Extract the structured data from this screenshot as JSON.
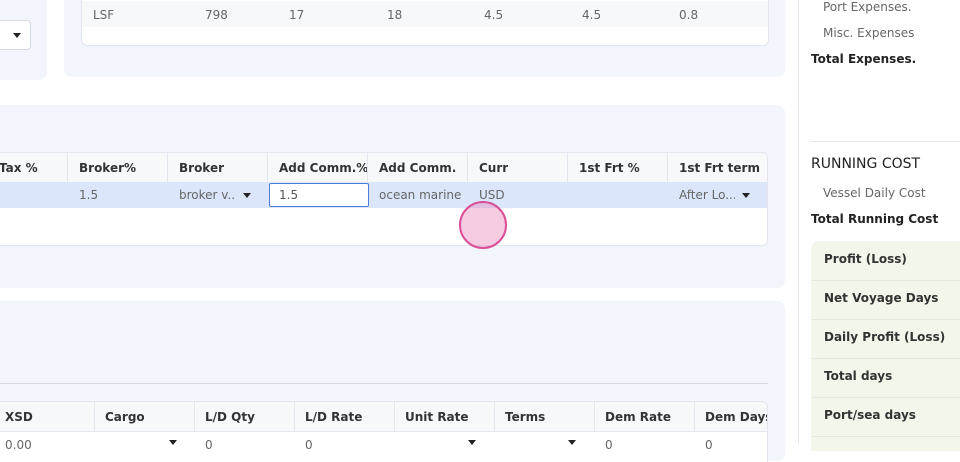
{
  "top_left": {
    "dropdown": ""
  },
  "fuel_table": {
    "row": [
      "LSF",
      "798",
      "17",
      "18",
      "4.5",
      "4.5",
      "0.8"
    ]
  },
  "commission_table": {
    "headers": [
      "Tax %",
      "Broker%",
      "Broker",
      "Add Comm.%",
      "Add Comm.",
      "Curr",
      "1st Frt %",
      "1st Frt term"
    ],
    "row": {
      "tax": "",
      "broker_pct": "1.5",
      "broker": "broker v...",
      "add_comm_pct": "1.5",
      "add_comm": "ocean marine",
      "curr": "USD",
      "first_frt_pct": "",
      "first_frt_term": "After Lo..."
    }
  },
  "cargo_table": {
    "headers": [
      "XSD",
      "Cargo",
      "L/D Qty",
      "L/D Rate",
      "Unit Rate",
      "Terms",
      "Dem Rate",
      "Dem Days"
    ],
    "row": [
      "0.00",
      "",
      "0",
      "0",
      "",
      "",
      "0",
      "0"
    ]
  },
  "sidebar": {
    "expenses": [
      "Port Expenses.",
      "Misc. Expenses"
    ],
    "total_expenses": "Total Expenses.",
    "running_cost_title": "RUNNING COST",
    "vessel_daily_cost": "Vessel Daily Cost",
    "total_running_cost": "Total Running Cost",
    "summary_rows": [
      "Profit (Loss)",
      "Net Voyage Days",
      "Daily Profit (Loss)",
      "Total days",
      "Port/sea days"
    ]
  },
  "colors": {
    "panel": "#f3f5fd",
    "selected_row": "#dbe6fb",
    "cursor": "#e98fbf",
    "summary_card": "#f3f6ea"
  }
}
